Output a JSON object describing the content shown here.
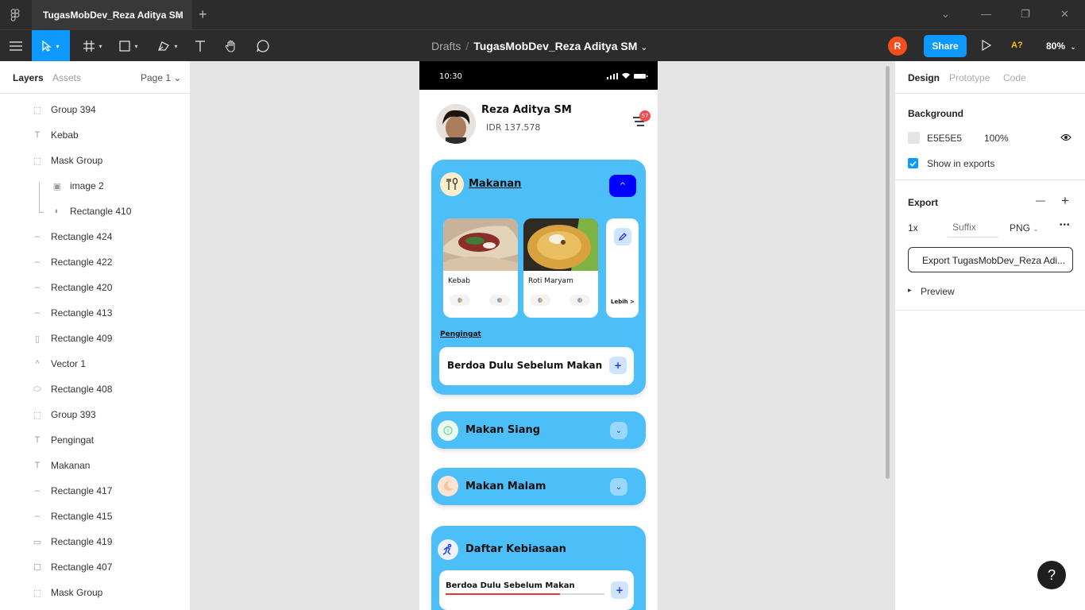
{
  "window": {
    "tab_title": "TugasMobDev_Reza Aditya SM",
    "close_glyph": "×",
    "new_tab_glyph": "+",
    "controls": [
      "⌄",
      "—",
      "❐",
      "✕"
    ]
  },
  "toolbar": {
    "breadcrumb_root": "Drafts",
    "breadcrumb_sep": "/",
    "file_name": "TugasMobDev_Reza Aditya SM",
    "file_caret": "⌄",
    "avatar_initial": "R",
    "share_label": "Share",
    "accessibility_label": "A?",
    "zoom": "80%",
    "zoom_caret": "⌄"
  },
  "left_panel": {
    "tabs": [
      "Layers",
      "Assets"
    ],
    "page": "Page 1 ⌄",
    "layers": [
      {
        "name": "Group 394",
        "icon": "group-icon",
        "glyph": "⬚",
        "indent": false
      },
      {
        "name": "Kebab",
        "icon": "text-icon",
        "glyph": "T",
        "indent": false
      },
      {
        "name": "Mask Group",
        "icon": "group-icon",
        "glyph": "⬚",
        "indent": false
      },
      {
        "name": "image 2",
        "icon": "image-icon",
        "glyph": "▣",
        "indent": true
      },
      {
        "name": "Rectangle 410",
        "icon": "mask-icon",
        "glyph": "◐",
        "indent": true
      },
      {
        "name": "Rectangle 424",
        "icon": "line-icon",
        "glyph": "┄",
        "indent": false
      },
      {
        "name": "Rectangle 422",
        "icon": "line-icon",
        "glyph": "┄",
        "indent": false
      },
      {
        "name": "Rectangle 420",
        "icon": "line-icon",
        "glyph": "┄",
        "indent": false
      },
      {
        "name": "Rectangle 413",
        "icon": "line-icon",
        "glyph": "┄",
        "indent": false
      },
      {
        "name": "Rectangle 409",
        "icon": "rectangle-icon",
        "glyph": "▯",
        "indent": false
      },
      {
        "name": "Vector 1",
        "icon": "vector-icon",
        "glyph": "^",
        "indent": false
      },
      {
        "name": "Rectangle 408",
        "icon": "rounded-rectangle-icon",
        "glyph": "⬭",
        "indent": false
      },
      {
        "name": "Group 393",
        "icon": "group-icon",
        "glyph": "⬚",
        "indent": false
      },
      {
        "name": "Pengingat",
        "icon": "text-icon",
        "glyph": "T",
        "indent": false
      },
      {
        "name": "Makanan",
        "icon": "text-icon",
        "glyph": "T",
        "indent": false
      },
      {
        "name": "Rectangle 417",
        "icon": "line-icon",
        "glyph": "┄",
        "indent": false
      },
      {
        "name": "Rectangle 415",
        "icon": "line-icon",
        "glyph": "┄",
        "indent": false
      },
      {
        "name": "Rectangle 419",
        "icon": "rectangle-icon",
        "glyph": "▭",
        "indent": false
      },
      {
        "name": "Rectangle 407",
        "icon": "rectangle-icon",
        "glyph": "☐",
        "indent": false
      },
      {
        "name": "Mask Group",
        "icon": "group-icon",
        "glyph": "⬚",
        "indent": false
      }
    ]
  },
  "phone": {
    "time": "10:30",
    "user_name": "Reza Aditya SM",
    "balance": "IDR 137.578",
    "notif_count": "57",
    "makanan": {
      "title": "Makanan",
      "toggle_glyph": "^",
      "foods": [
        {
          "name": "Kebab"
        },
        {
          "name": "Roti Maryam"
        }
      ],
      "more_label": "Lebih >",
      "reminder_label": "Pengingat",
      "reminder_text": "Berdoa Dulu Sebelum Makan",
      "plus_glyph": "+"
    },
    "makan_siang": {
      "title": "Makan Siang",
      "toggle_glyph": "⌄"
    },
    "makan_malam": {
      "title": "Makan Malam",
      "toggle_glyph": "⌄"
    },
    "kebiasaan": {
      "title": "Daftar Kebiasaan",
      "habit_text": "Berdoa Dulu Sebelum Makan",
      "progress": 0.72,
      "plus_glyph": "+"
    }
  },
  "right_panel": {
    "tabs": [
      "Design",
      "Prototype",
      "Code"
    ],
    "background_label": "Background",
    "bg_hex": "E5E5E5",
    "bg_opacity": "100%",
    "show_in_exports": "Show in exports",
    "export_label": "Export",
    "minus_glyph": "—",
    "plus_glyph": "+",
    "scale": "1x",
    "suffix_placeholder": "Suffix",
    "format": "PNG",
    "format_caret": "⌄",
    "more_glyph": "•••",
    "export_button": "Export TugasMobDev_Reza Adi...",
    "preview_label": "Preview",
    "preview_caret": "▸"
  },
  "help_glyph": "?",
  "colors": {
    "accent": "#0d99ff",
    "card_blue": "#4dbff8",
    "deep_blue": "#0000ff",
    "progress_red": "#e53935"
  }
}
